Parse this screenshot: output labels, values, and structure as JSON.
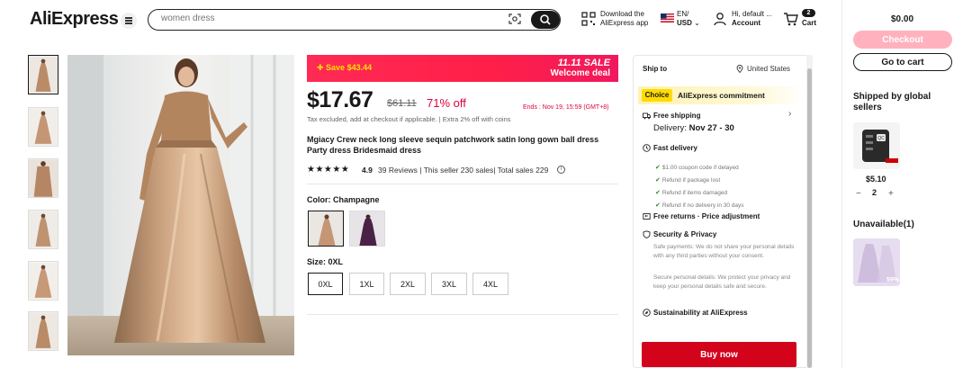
{
  "header": {
    "logo": "AliExpress",
    "search_placeholder": "women dress",
    "download_line1": "Download the",
    "download_line2": "AliExpress app",
    "lang_line1": "EN/",
    "lang_line2": "USD",
    "account_line1": "Hi, default ...",
    "account_line2": "Account",
    "cart_count": "2",
    "cart_label": "Cart"
  },
  "promo": {
    "save": "Save $43.44",
    "sale_title": "11.11 SALE",
    "sale_sub": "Welcome deal"
  },
  "product": {
    "price": "$17.67",
    "old_price": "$61.11",
    "discount": "71% off",
    "ends": "Ends :  Nov 19, 15:59 (GMT+8)",
    "tax_note": "Tax excluded, add at checkout if applicable.  |  Extra 2% off with coins",
    "title": "Mgiacy Crew neck long sleeve sequin patchwork satin long gown ball dress Party dress Bridesmaid dress",
    "stars": "★★★★★",
    "rating": "4.9",
    "reviews": "39 Reviews  |  This seller 230 sales|  Total sales 229",
    "color_label": "Color: Champagne",
    "size_label": "Size: 0XL",
    "sizes": [
      "0XL",
      "1XL",
      "2XL",
      "3XL",
      "4XL"
    ]
  },
  "shipping": {
    "ship_to": "Ship to",
    "country": "United States",
    "choice_badge": "Choice",
    "choice_text": "AliExpress commitment",
    "free_shipping": "Free shipping",
    "delivery_prefix": "Delivery: ",
    "delivery_dates": "Nov 27 - 30",
    "fast_delivery": "Fast delivery",
    "fast_items": [
      "$1.00 coupon code if delayed",
      "Refund if package lost",
      "Refund if items damaged",
      "Refund if no delivery in 30 days"
    ],
    "free_returns": "Free returns · Price adjustment",
    "security": "Security & Privacy",
    "security_p1": "Safe payments: We do not share your personal details with any third parties without your consent.",
    "security_p2": "Secure personal details: We protect your privacy and keep your personal details safe and secure.",
    "sustainability": "Sustainability at AliExpress",
    "buy_now": "Buy now"
  },
  "sidebar": {
    "total": "$0.00",
    "checkout": "Checkout",
    "goto_cart": "Go to cart",
    "shipped_title": "Shipped by global sellers",
    "item_price": "$5.10",
    "qty_minus": "−",
    "qty": "2",
    "qty_plus": "+",
    "unavailable": "Unavailable(1)",
    "unavail_pct": "59%"
  },
  "colors": {
    "brand_red": "#e43225",
    "price_red": "#e0003c",
    "buy_red": "#d3031c",
    "choice_yellow": "#ffdb00",
    "checkout_pink": "#ffb2bd",
    "dress_champagne": "#c9a07e"
  }
}
